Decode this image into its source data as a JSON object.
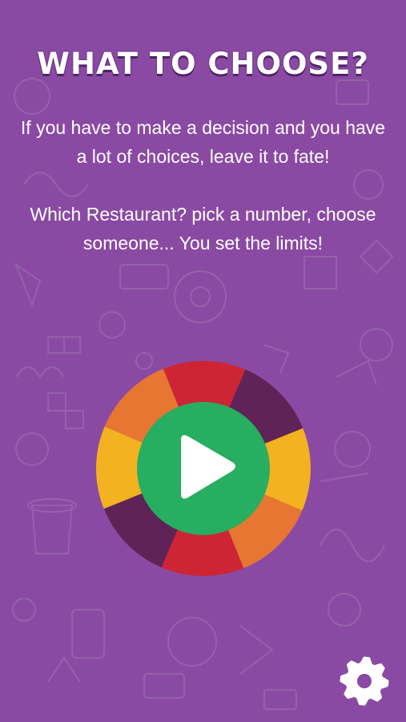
{
  "title": "WHAT TO CHOOSE?",
  "description_1": "If you have to make a decision and you have a lot of choices, leave it to fate!",
  "description_2": "Which Restaurant? pick a number, choose someone... You set the limits!",
  "wheel": {
    "segment_colors": [
      "#cd2534",
      "#5f2357",
      "#f3b21f",
      "#e67631",
      "#cd2534",
      "#5f2357",
      "#f3b21f",
      "#e67631"
    ],
    "play_icon": "play-icon",
    "play_color": "#27ae60"
  },
  "settings": {
    "icon": "gear-icon"
  },
  "colors": {
    "background": "#8a4aa3",
    "text": "#ffffff"
  }
}
